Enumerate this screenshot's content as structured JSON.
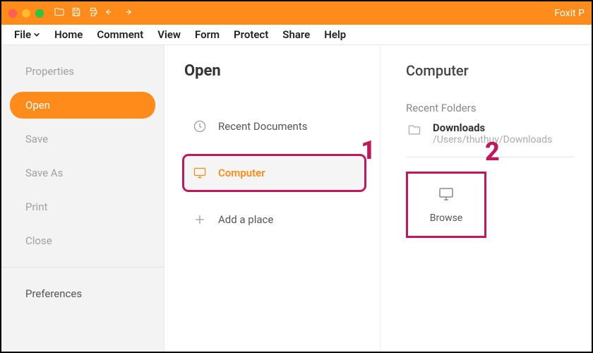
{
  "app": {
    "title": "Foxit P"
  },
  "menubar": {
    "file": "File",
    "home": "Home",
    "comment": "Comment",
    "view": "View",
    "form": "Form",
    "protect": "Protect",
    "share": "Share",
    "help": "Help"
  },
  "sidebar": {
    "properties": "Properties",
    "open": "Open",
    "save": "Save",
    "saveas": "Save As",
    "print": "Print",
    "close": "Close",
    "preferences": "Preferences"
  },
  "mid": {
    "title": "Open",
    "recent_documents": "Recent Documents",
    "computer": "Computer",
    "add_place": "Add a place"
  },
  "right": {
    "title": "Computer",
    "recent_label": "Recent Folders",
    "recent_name": "Downloads",
    "recent_path": "/Users/thuthuy/Downloads",
    "browse": "Browse"
  },
  "annotations": {
    "one": "1",
    "two": "2"
  }
}
